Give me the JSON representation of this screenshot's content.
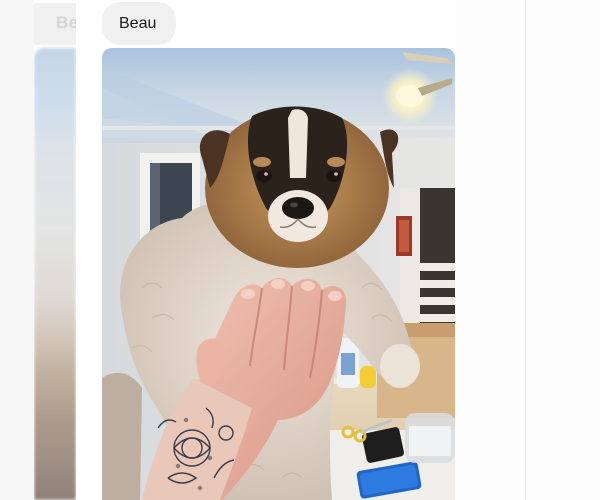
{
  "post": {
    "name_label": "Beau",
    "previous_name_label": "Be"
  },
  "photo": {
    "subject": "puppy-held-in-hands",
    "colors": {
      "fur_tan": "#b8874f",
      "fur_dark": "#2b221c",
      "fur_light": "#e9ddd0",
      "ceiling": "#b4cde4"
    }
  }
}
